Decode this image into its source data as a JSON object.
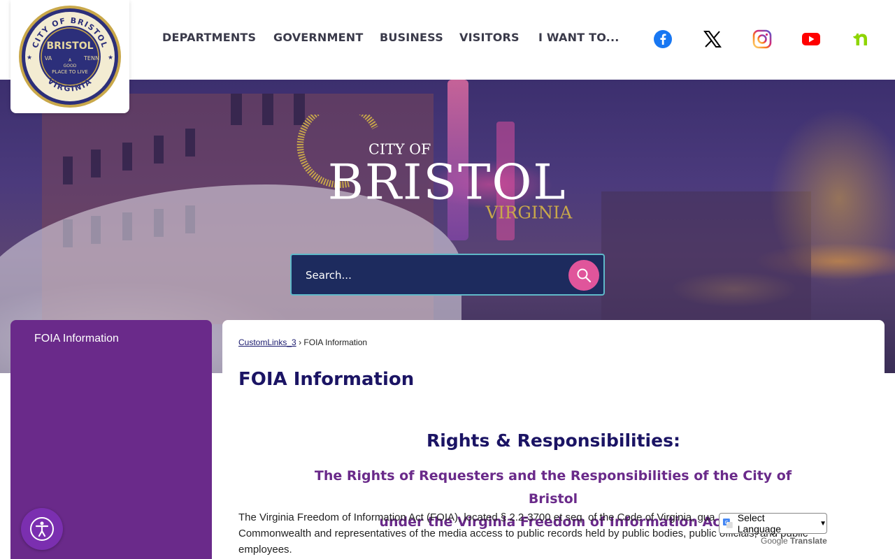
{
  "header": {
    "logo": {
      "city": "CITY OF BRISTOL",
      "name": "BRISTOL",
      "left": "VA",
      "right": "TENN",
      "center": "A",
      "motto1": "GOOD",
      "motto2": "PLACE TO LIVE",
      "state": "VIRGINIA"
    },
    "nav": [
      "DEPARTMENTS",
      "GOVERNMENT",
      "BUSINESS",
      "VISITORS",
      "I WANT TO..."
    ],
    "social": [
      {
        "name": "facebook-icon",
        "color": "#1877f2"
      },
      {
        "name": "x-icon",
        "color": "#000000"
      },
      {
        "name": "instagram-icon",
        "color": "#d6249f"
      },
      {
        "name": "youtube-icon",
        "color": "#ff0000"
      },
      {
        "name": "nextdoor-icon",
        "color": "#8ed500"
      }
    ]
  },
  "hero": {
    "city_of": "CITY OF",
    "bristol": "BRISTOL",
    "virginia": "VIRGINIA",
    "search_placeholder": "Search..."
  },
  "sidebar": {
    "title": "FOIA Information"
  },
  "main": {
    "breadcrumb_link": "CustomLinks_3",
    "breadcrumb_separator": "›",
    "breadcrumb_current": "FOIA Information",
    "title": "FOIA Information",
    "section_heading": "Rights & Responsibilities:",
    "sub_heading_line1": "The Rights of Requesters and the Responsibilities of the City of Bristol",
    "sub_heading_line2": "under the Virginia Freedom of Information Act",
    "body_line1": "The Virginia Freedom of Information Act (FOIA), located § 2.2-3700 et seq. of the Code of Virginia, gua",
    "body_line2": "Commonwealth and representatives of the media access to public records held by public bodies, public officials, and public",
    "body_line3": "employees."
  },
  "widgets": {
    "translate_label": "Select Language",
    "powered_by": "Google",
    "translate_word": "Translate"
  },
  "colors": {
    "accent_purple": "#6a2a8a",
    "navy": "#1b1464",
    "search_bg": "#1d2b5e",
    "search_button": "#e0559b",
    "gold": "#c9a84a"
  }
}
